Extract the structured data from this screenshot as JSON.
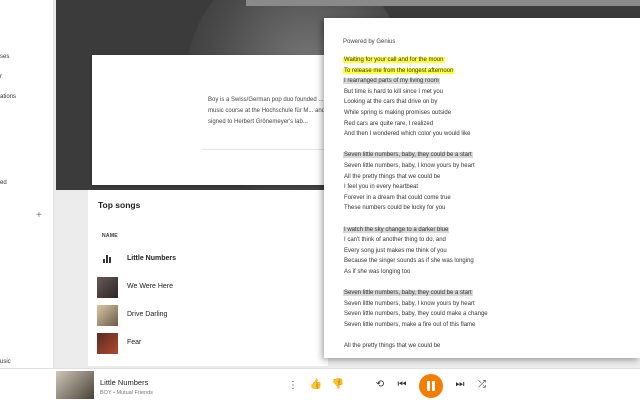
{
  "sidebar": {
    "items": [
      "ses",
      "r",
      "ations",
      "ed",
      "usic"
    ]
  },
  "artist": {
    "bio": "Boy is a Swiss/German pop duo founded ... music course at the Hochschule für M... and signed to Herbert Grönemeyer's lab..."
  },
  "top_songs": {
    "title": "Top songs",
    "column_name": "NAME",
    "songs": [
      {
        "title": "Little Numbers",
        "playing": true
      },
      {
        "title": "We Were Here",
        "playing": false
      },
      {
        "title": "Drive Darling",
        "playing": false
      },
      {
        "title": "Fear",
        "playing": false
      }
    ]
  },
  "lyrics": {
    "powered_by": "Powered by Genius",
    "lines": [
      {
        "text": "Waiting for your call and for the moon",
        "hl": "yellow"
      },
      {
        "text": "To release me from the longest afternoon",
        "hl": "yellow"
      },
      {
        "text": "I rearranged parts of my living room",
        "hl": "grey"
      },
      {
        "text": "But time is hard to kill since I met you",
        "hl": ""
      },
      {
        "text": "Looking at the cars that drive on by",
        "hl": ""
      },
      {
        "text": "While spring is making promises outside",
        "hl": ""
      },
      {
        "text": "Red cars are quite rare, I realized",
        "hl": ""
      },
      {
        "text": "And then I wondered which color you would like",
        "hl": ""
      },
      {
        "text": "",
        "hl": ""
      },
      {
        "text": "Seven little numbers, baby, they could be a start",
        "hl": "grey"
      },
      {
        "text": "Seven little numbers, baby, I know yours by heart",
        "hl": ""
      },
      {
        "text": "All the pretty things that we could be",
        "hl": ""
      },
      {
        "text": "I feel you in every heartbeat",
        "hl": ""
      },
      {
        "text": "Forever in a dream that could come true",
        "hl": ""
      },
      {
        "text": "These numbers could be lucky for you",
        "hl": ""
      },
      {
        "text": "",
        "hl": ""
      },
      {
        "text": "I watch the sky change to a darker blue",
        "hl": "grey"
      },
      {
        "text": "I can't think of another thing to do, and",
        "hl": ""
      },
      {
        "text": "Every song just makes me think of you",
        "hl": ""
      },
      {
        "text": "Because the singer sounds as if she was longing",
        "hl": ""
      },
      {
        "text": "As if she was longing too",
        "hl": ""
      },
      {
        "text": "",
        "hl": ""
      },
      {
        "text": "Seven little numbers, baby, they could be a start",
        "hl": "grey"
      },
      {
        "text": "Seven little numbers, baby, I know yours by heart",
        "hl": ""
      },
      {
        "text": "Seven little numbers, baby, they could make a change",
        "hl": ""
      },
      {
        "text": "Seven little numbers, make a fire out of this flame",
        "hl": ""
      },
      {
        "text": "",
        "hl": ""
      },
      {
        "text": "All the pretty things that we could be",
        "hl": ""
      }
    ]
  },
  "player": {
    "title": "Little Numbers",
    "artist": "BOY",
    "album": "Mutual Friends",
    "separator": "•",
    "accent": "#f57c00"
  }
}
